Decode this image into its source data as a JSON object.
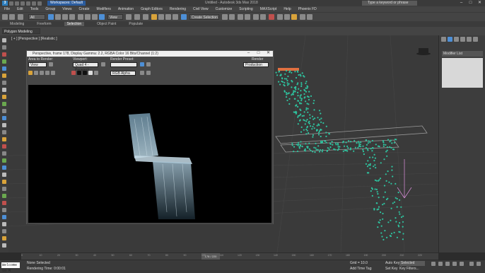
{
  "app": {
    "title": "Untitled - Autodesk 3ds Max 2018",
    "workspace": "Workspaces: Default",
    "search_placeholder": "Type a keyword or phrase",
    "window_buttons": [
      "–",
      "□",
      "✕"
    ]
  },
  "menu": [
    "File",
    "Edit",
    "Tools",
    "Group",
    "Views",
    "Create",
    "Modifiers",
    "Animation",
    "Graph Editors",
    "Rendering",
    "Civil View",
    "Customize",
    "Scripting",
    "MAXScript",
    "Help",
    "Phoenix FD"
  ],
  "toolbar": {
    "filter": "All",
    "view_dd": "View",
    "selection_set": "Create Selection Se"
  },
  "tabs": [
    "Modeling",
    "Freeform",
    "Selection",
    "Object Paint",
    "Populate"
  ],
  "active_tab": "Selection",
  "ribbon": {
    "object_paint_label": "Polygon Modeling"
  },
  "viewport": {
    "label": "[ + ] [Perspective ] [Realistic ]"
  },
  "command_panel": {
    "modifier_list": "Modifier List"
  },
  "render_window": {
    "title": "Perspective, frame 178, Display Gamma: 2.2, RGBA Color 16 Bits/Channel (1:2)",
    "area_to_render_label": "Area to Render:",
    "area_to_render": "View",
    "viewport_label": "Viewport:",
    "viewport_value": "Quad 4 - Perspect",
    "render_preset_label": "Render Preset:",
    "render_preset_value": "",
    "render_btn": "Render",
    "production": "Production",
    "channel": "RGB Alpha"
  },
  "timeline": {
    "slider": "178 / 220",
    "ticks": [
      "0",
      "10",
      "20",
      "30",
      "40",
      "50",
      "60",
      "70",
      "80",
      "90",
      "100",
      "110",
      "120",
      "130",
      "140",
      "150",
      "160",
      "170",
      "180",
      "190",
      "200",
      "210",
      "220"
    ]
  },
  "status": {
    "none_selected": "None Selected",
    "rendering_time": "Rendering Time: 0:00:01",
    "welcome": "Welcome to M",
    "grid": "Grid = 10.0",
    "add_time_tag": "Add Time Tag",
    "auto_key": "Auto Key",
    "selected": "Selected",
    "set_key": "Set Key",
    "key_filters": "Key Filters..."
  },
  "colors": {
    "accent": "#2b5c9e",
    "particles": "#2ec4a0",
    "water": "#9ec4d8"
  }
}
